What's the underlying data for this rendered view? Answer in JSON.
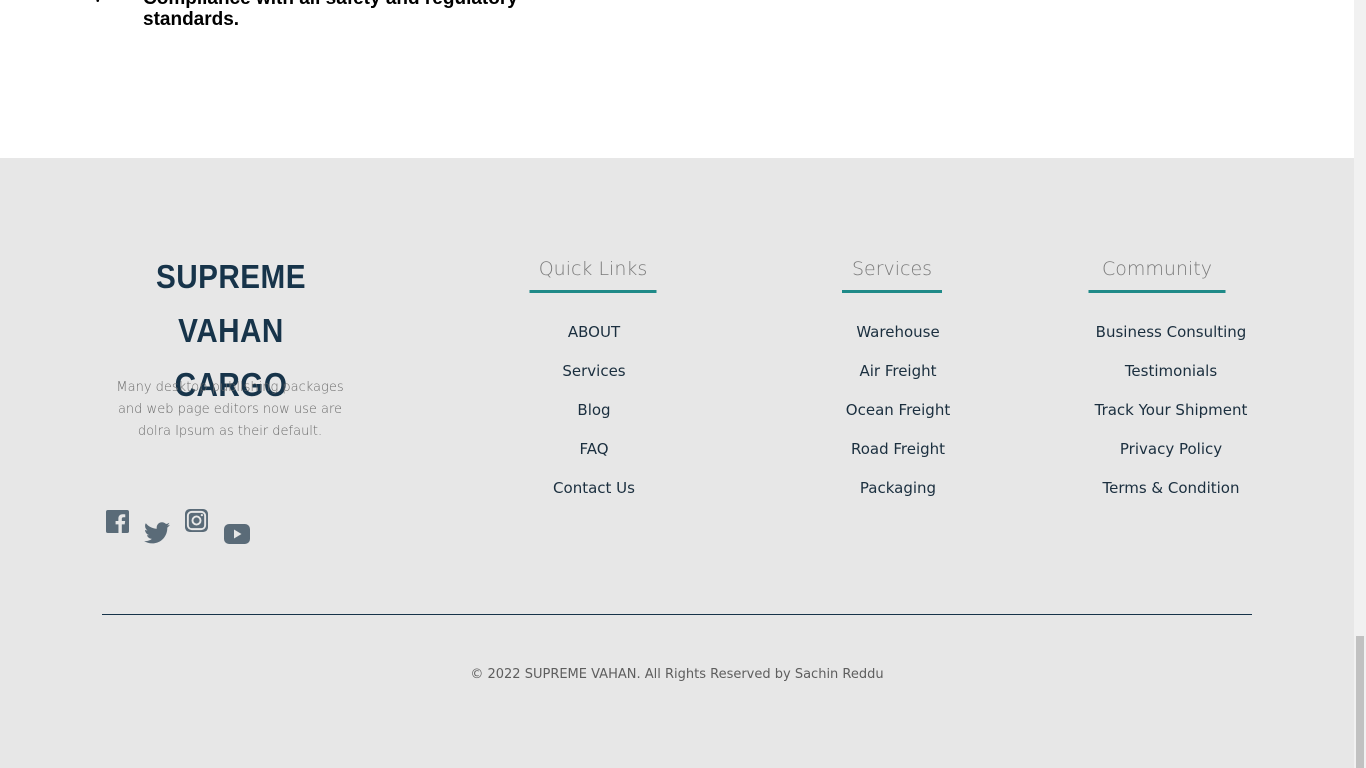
{
  "top": {
    "bullet_text": "Compliance with all safety and regulatory standards."
  },
  "footer": {
    "brand": {
      "line1": "SUPREME VAHAN",
      "line2": "CARGO",
      "description": "Many desktop publishing packages and web page editors now use are dolra Ipsum as their default."
    },
    "social": [
      {
        "name": "facebook-icon"
      },
      {
        "name": "twitter-icon"
      },
      {
        "name": "instagram-icon"
      },
      {
        "name": "youtube-icon"
      }
    ],
    "columns": {
      "quick_links": {
        "title": "Quick Links",
        "items": [
          "ABOUT",
          "Services",
          "Blog",
          "FAQ",
          "Contact Us"
        ]
      },
      "services": {
        "title": "Services",
        "items": [
          "Warehouse",
          "Air Freight",
          "Ocean Freight",
          "Road Freight",
          "Packaging"
        ]
      },
      "community": {
        "title": "Community",
        "items": [
          "Business Consulting",
          "Testimonials",
          "Track Your Shipment",
          "Privacy Policy",
          "Terms & Condition"
        ]
      }
    },
    "copyright": "© 2022 SUPREME VAHAN. All Rights Reserved by Sachin Reddu"
  },
  "colors": {
    "footer_bg": "#e7e7e7",
    "brand": "#17344a",
    "accent": "#1f8a88"
  }
}
